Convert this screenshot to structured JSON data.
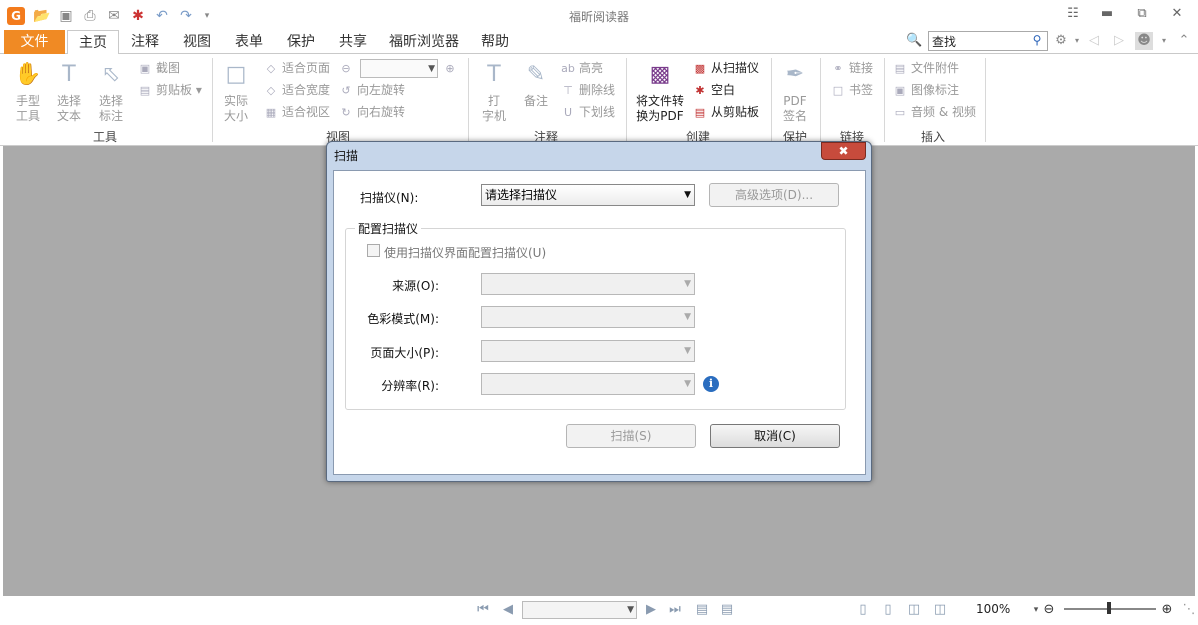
{
  "window": {
    "title": "福昕阅读器"
  },
  "ribbon_tabs": {
    "file": "文件",
    "items": [
      "主页",
      "注释",
      "视图",
      "表单",
      "保护",
      "共享",
      "福昕浏览器",
      "帮助"
    ]
  },
  "search": {
    "value": "查找"
  },
  "ribbon": {
    "tools": {
      "hand": "手型\n工具",
      "select_text": "选择\n文本",
      "select_annot": "选择\n标注",
      "snapshot": "截图",
      "clipboard": "剪贴板",
      "group": "工具"
    },
    "view": {
      "actual_size": "实际\n大小",
      "fit_page": "适合页面",
      "fit_width": "适合宽度",
      "fit_visible": "适合视区",
      "rotate_left": "向左旋转",
      "rotate_right": "向右旋转",
      "group": "视图"
    },
    "comment": {
      "typewriter": "打\n字机",
      "note": "备注",
      "highlight": "高亮",
      "strikeout": "删除线",
      "underline": "下划线",
      "group": "注释"
    },
    "create": {
      "to_pdf": "将文件转\n换为PDF",
      "from_scanner": "从扫描仪",
      "blank": "空白",
      "from_clipboard": "从剪贴板",
      "group": "创建"
    },
    "protect": {
      "sign": "PDF\n签名",
      "group": "保护"
    },
    "links": {
      "link": "链接",
      "bookmark": "书签",
      "group": "链接"
    },
    "insert": {
      "attachment": "文件附件",
      "image_annot": "图像标注",
      "av": "音频 & 视频",
      "group": "插入"
    }
  },
  "status": {
    "zoom": "100%"
  },
  "dialog": {
    "title": "扫描",
    "scanner_label": "扫描仪(N):",
    "scanner_value": "请选择扫描仪",
    "advanced_button": "高级选项(D)...",
    "config_group": "配置扫描仪",
    "use_ui_checkbox": "使用扫描仪界面配置扫描仪(U)",
    "source_label": "来源(O):",
    "color_label": "色彩模式(M):",
    "pagesize_label": "页面大小(P):",
    "resolution_label": "分辨率(R):",
    "scan_button": "扫描(S)",
    "cancel_button": "取消(C)"
  }
}
